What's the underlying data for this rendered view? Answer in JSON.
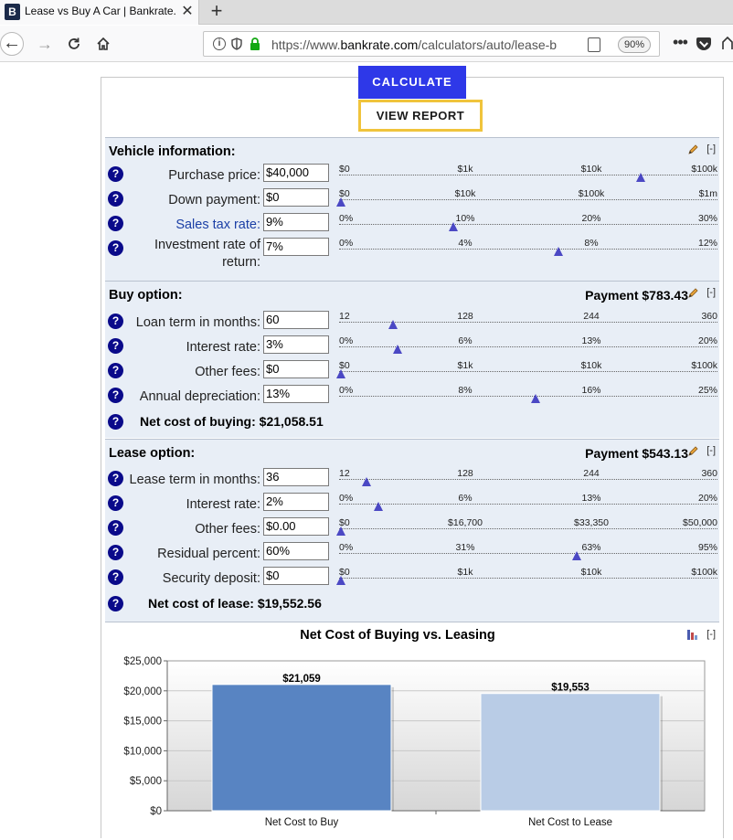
{
  "browser": {
    "tab_title": "Lease vs Buy A Car | Bankrate.com",
    "favicon_letter": "B",
    "tab_close": "✕",
    "new_tab": "+",
    "url_prefix": "https://www.",
    "url_domain": "bankrate.com",
    "url_path": "/calculators/auto/lease-b",
    "zoom": "90%"
  },
  "actions": {
    "calculate": "CALCULATE",
    "view_report": "VIEW REPORT"
  },
  "vehicle": {
    "title": "Vehicle information:",
    "collapse": "[-]",
    "rows": [
      {
        "label": "Purchase price:",
        "value": "$40,000",
        "ticks": [
          "$0",
          "$1k",
          "$10k",
          "$100k"
        ],
        "thumb": 0.8
      },
      {
        "label": "Down payment:",
        "value": "$0",
        "ticks": [
          "$0",
          "$10k",
          "$100k",
          "$1m"
        ],
        "thumb": 0.0
      },
      {
        "label": "Sales tax rate:",
        "value": "9%",
        "ticks": [
          "0%",
          "10%",
          "20%",
          "30%"
        ],
        "thumb": 0.3
      },
      {
        "label": "Investment rate of return:",
        "value": "7%",
        "ticks": [
          "0%",
          "4%",
          "8%",
          "12%"
        ],
        "thumb": 0.58
      }
    ]
  },
  "buy": {
    "title": "Buy option:",
    "payment": "Payment $783.43",
    "collapse": "[-]",
    "rows": [
      {
        "label": "Loan term in months:",
        "value": "60",
        "ticks": [
          "12",
          "128",
          "244",
          "360"
        ],
        "thumb": 0.138
      },
      {
        "label": "Interest rate:",
        "value": "3%",
        "ticks": [
          "0%",
          "6%",
          "13%",
          "20%"
        ],
        "thumb": 0.15
      },
      {
        "label": "Other fees:",
        "value": "$0",
        "ticks": [
          "$0",
          "$1k",
          "$10k",
          "$100k"
        ],
        "thumb": 0.0
      },
      {
        "label": "Annual depreciation:",
        "value": "13%",
        "ticks": [
          "0%",
          "8%",
          "16%",
          "25%"
        ],
        "thumb": 0.52
      }
    ],
    "summary": "Net cost of buying: $21,058.51"
  },
  "lease": {
    "title": "Lease option:",
    "payment": "Payment $543.13",
    "collapse": "[-]",
    "rows": [
      {
        "label": "Lease term in months:",
        "value": "36",
        "ticks": [
          "12",
          "128",
          "244",
          "360"
        ],
        "thumb": 0.069
      },
      {
        "label": "Interest rate:",
        "value": "2%",
        "ticks": [
          "0%",
          "6%",
          "13%",
          "20%"
        ],
        "thumb": 0.1
      },
      {
        "label": "Other fees:",
        "value": "$0.00",
        "ticks": [
          "$0",
          "$16,700",
          "$33,350",
          "$50,000"
        ],
        "thumb": 0.0
      },
      {
        "label": "Residual percent:",
        "value": "60%",
        "ticks": [
          "0%",
          "31%",
          "63%",
          "95%"
        ],
        "thumb": 0.63
      },
      {
        "label": "Security deposit:",
        "value": "$0",
        "ticks": [
          "$0",
          "$1k",
          "$10k",
          "$100k"
        ],
        "thumb": 0.0
      }
    ],
    "summary": "Net cost of lease: $19,552.56"
  },
  "chart_data": {
    "type": "bar",
    "title": "Net Cost of Buying vs. Leasing",
    "categories": [
      "Net Cost to Buy",
      "Net Cost to Lease"
    ],
    "values": [
      21059,
      19553
    ],
    "data_labels": [
      "$21,059",
      "$19,553"
    ],
    "colors": [
      "#5884c2",
      "#b9cce6"
    ],
    "ylim": [
      0,
      25000
    ],
    "yticks": [
      "$25,000",
      "$20,000",
      "$15,000",
      "$10,000",
      "$5,000",
      "$0"
    ],
    "collapse": "[-]"
  }
}
